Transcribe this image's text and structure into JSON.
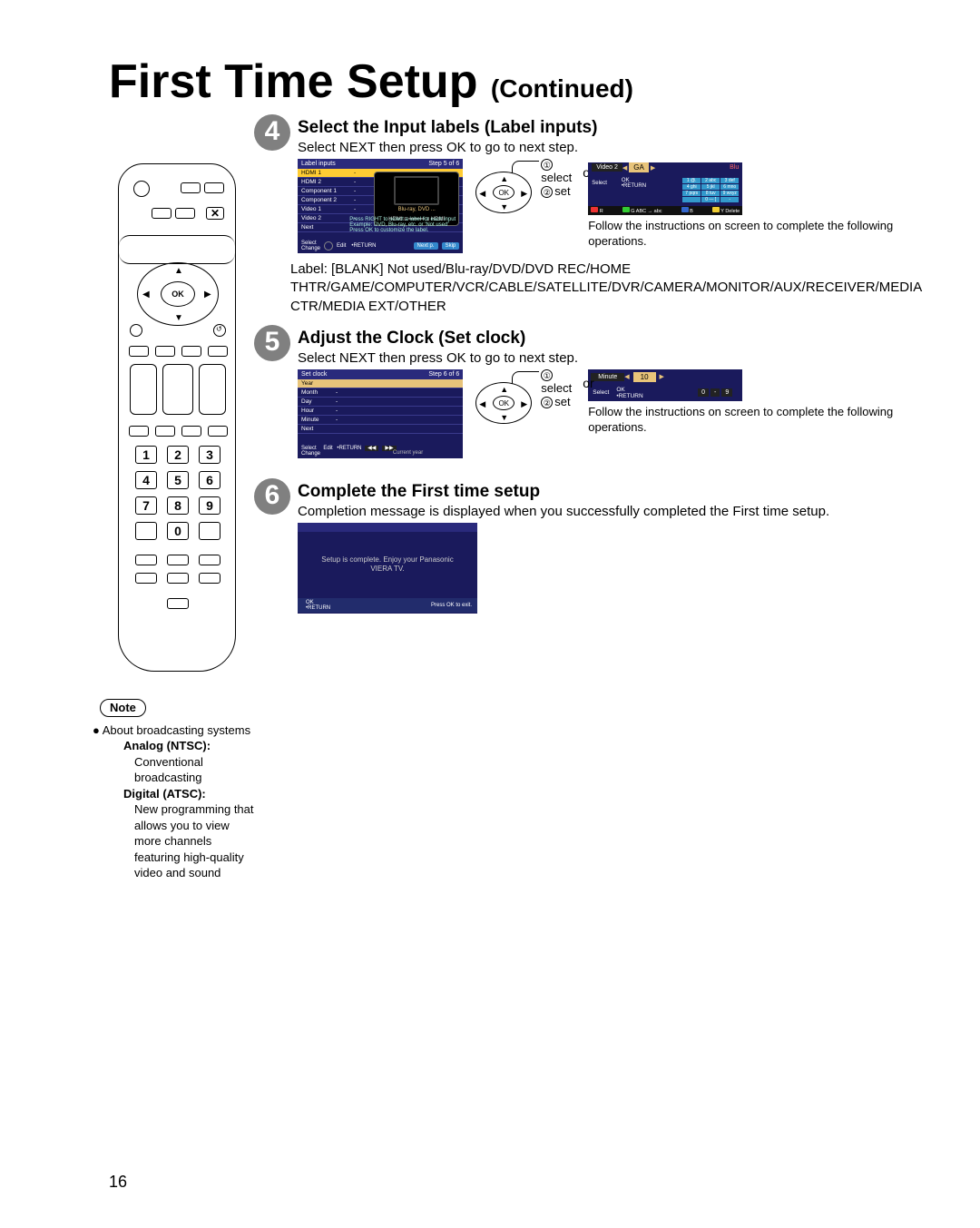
{
  "title_main": "First Time Setup",
  "title_cont": "(Continued)",
  "remote": {
    "ok": "OK",
    "x": "✕",
    "nums": [
      "1",
      "2",
      "3",
      "4",
      "5",
      "6",
      "7",
      "8",
      "9",
      "0"
    ]
  },
  "steps": {
    "s4": {
      "num": "4",
      "heading": "Select the Input labels (Label inputs)",
      "sub": "Select NEXT then press OK to go to next step.",
      "or": "or",
      "sel": "select",
      "set": "set",
      "c1": "①",
      "c2": "②",
      "osd": {
        "title": "Label inputs",
        "step": "Step 5 of 6",
        "rows": [
          [
            "HDMI 1",
            "-"
          ],
          [
            "HDMI 2",
            "-"
          ],
          [
            "Component 1",
            "-"
          ],
          [
            "Component 2",
            "-"
          ],
          [
            "Video 1",
            "-"
          ],
          [
            "Video 2",
            "-"
          ],
          [
            "Next",
            ""
          ]
        ],
        "blu": "Blu-ray, DVD ...",
        "hdmi": "HDMI",
        "hint1": "Press RIGHT to select a label for each input",
        "hint2": "Example: DVD, Blu-ray, etc. or 'Not used'",
        "hint3": "Press OK to customize the label.",
        "sel_lbl": "Select",
        "ch_lbl": "Change",
        "edit_lbl": "Edit",
        "ret": "RETURN",
        "next": "Next p.",
        "skip": "Skip"
      },
      "edit": {
        "name": "Video 2",
        "value": "GA",
        "blu": "Blu",
        "kb": [
          "1 @.",
          "2 abc",
          "3 def",
          "4 ghi",
          "5 jkl",
          "6 mno",
          "7 pqrs",
          "8 tuv",
          "9 wxyz",
          "",
          "0 — [",
          "-"
        ],
        "sel": "Select",
        "okl": "OK",
        "ret": "RETURN",
        "r_lbl": "R",
        "g_lbl": "G ABC → abc",
        "b_lbl": "B",
        "y_lbl": "Y Delete"
      },
      "foot": "Follow the instructions on screen to complete the following operations.",
      "label_txt": "Label: [BLANK] Not used/Blu-ray/DVD/DVD REC/HOME THTR/GAME/COMPUTER/VCR/CABLE/SATELLITE/DVR/CAMERA/MONITOR/AUX/RECEIVER/MEDIA CTR/MEDIA EXT/OTHER"
    },
    "s5": {
      "num": "5",
      "heading": "Adjust the Clock (Set clock)",
      "sub": "Select NEXT then press OK to go to next step.",
      "or": "or",
      "sel": "select",
      "set": "set",
      "c1": "①",
      "c2": "②",
      "osd": {
        "title": "Set clock",
        "step": "Step 6 of 6",
        "rows": [
          [
            "Year",
            ""
          ],
          [
            "Month",
            "-"
          ],
          [
            "Day",
            "-"
          ],
          [
            "Hour",
            "-"
          ],
          [
            "Minute",
            "-"
          ],
          [
            "Next",
            ""
          ]
        ],
        "sel_lbl": "Select",
        "ch_lbl": "Change",
        "edit_lbl": "Edit",
        "ret": "RETURN",
        "cur": "Current year"
      },
      "min": {
        "name": "Minute",
        "value": "10",
        "z0": "0",
        "zd": "-",
        "z9": "9",
        "sel": "Select",
        "okl": "OK",
        "ret": "RETURN"
      },
      "foot": "Follow the instructions on screen to complete the following operations."
    },
    "s6": {
      "num": "6",
      "heading": "Complete the First time setup",
      "sub": "Completion message is displayed when you successfully completed the First time setup.",
      "msg": "Setup is complete. Enjoy your Panasonic VIERA TV.",
      "okl": "OK",
      "ret": "RETURN",
      "exit": "Press OK to exit."
    }
  },
  "dpad": {
    "ok": "OK"
  },
  "note": {
    "label": "Note",
    "lead_bullet": "●",
    "lead": "About broadcasting systems",
    "an_t": "Analog (NTSC):",
    "an_d": "Conventional broadcasting",
    "di_t": "Digital (ATSC):",
    "di_d": "New programming that allows you to view more channels featuring high-quality video and sound"
  },
  "page_num": "16"
}
